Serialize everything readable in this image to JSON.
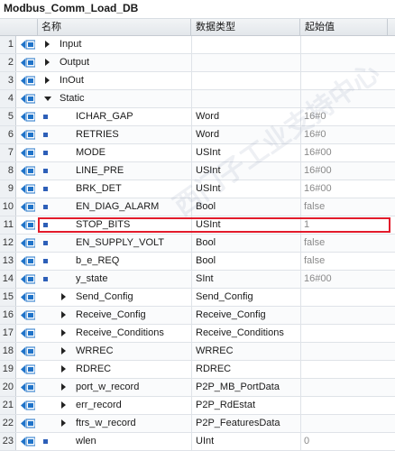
{
  "title": "Modbus_Comm_Load_DB",
  "columns": {
    "name": "名称",
    "data_type": "数据类型",
    "start_value": "起始值"
  },
  "colors": {
    "highlight": "#e21b2b",
    "bullet": "#2d5fb8",
    "io_icon": "#1f73c9"
  },
  "rows": [
    {
      "num": "1",
      "name": "Input",
      "type": "",
      "init": "",
      "arrow": "right",
      "level": 0
    },
    {
      "num": "2",
      "name": "Output",
      "type": "",
      "init": "",
      "arrow": "right",
      "level": 0
    },
    {
      "num": "3",
      "name": "InOut",
      "type": "",
      "init": "",
      "arrow": "right",
      "level": 0
    },
    {
      "num": "4",
      "name": "Static",
      "type": "",
      "init": "",
      "arrow": "down",
      "level": 0
    },
    {
      "num": "5",
      "name": "ICHAR_GAP",
      "type": "Word",
      "init": "16#0",
      "arrow": "",
      "level": 1
    },
    {
      "num": "6",
      "name": "RETRIES",
      "type": "Word",
      "init": "16#0",
      "arrow": "",
      "level": 1
    },
    {
      "num": "7",
      "name": "MODE",
      "type": "USInt",
      "init": "16#00",
      "arrow": "",
      "level": 1
    },
    {
      "num": "8",
      "name": "LINE_PRE",
      "type": "USInt",
      "init": "16#00",
      "arrow": "",
      "level": 1
    },
    {
      "num": "9",
      "name": "BRK_DET",
      "type": "USInt",
      "init": "16#00",
      "arrow": "",
      "level": 1
    },
    {
      "num": "10",
      "name": "EN_DIAG_ALARM",
      "type": "Bool",
      "init": "false",
      "arrow": "",
      "level": 1
    },
    {
      "num": "11",
      "name": "STOP_BITS",
      "type": "USInt",
      "init": "1",
      "arrow": "",
      "level": 1,
      "highlight": true
    },
    {
      "num": "12",
      "name": "EN_SUPPLY_VOLT",
      "type": "Bool",
      "init": "false",
      "arrow": "",
      "level": 1
    },
    {
      "num": "13",
      "name": "b_e_REQ",
      "type": "Bool",
      "init": "false",
      "arrow": "",
      "level": 1
    },
    {
      "num": "14",
      "name": "y_state",
      "type": "SInt",
      "init": "16#00",
      "arrow": "",
      "level": 1
    },
    {
      "num": "15",
      "name": "Send_Config",
      "type": "Send_Config",
      "init": "",
      "arrow": "right",
      "level": 1
    },
    {
      "num": "16",
      "name": "Receive_Config",
      "type": "Receive_Config",
      "init": "",
      "arrow": "right",
      "level": 1
    },
    {
      "num": "17",
      "name": "Receive_Conditions",
      "type": "Receive_Conditions",
      "init": "",
      "arrow": "right",
      "level": 1
    },
    {
      "num": "18",
      "name": "WRREC",
      "type": "WRREC",
      "init": "",
      "arrow": "right",
      "level": 1
    },
    {
      "num": "19",
      "name": "RDREC",
      "type": "RDREC",
      "init": "",
      "arrow": "right",
      "level": 1
    },
    {
      "num": "20",
      "name": "port_w_record",
      "type": "P2P_MB_PortData",
      "init": "",
      "arrow": "right",
      "level": 1
    },
    {
      "num": "21",
      "name": "err_record",
      "type": "P2P_RdEstat",
      "init": "",
      "arrow": "right",
      "level": 1
    },
    {
      "num": "22",
      "name": "ftrs_w_record",
      "type": "P2P_FeaturesData",
      "init": "",
      "arrow": "right",
      "level": 1
    },
    {
      "num": "23",
      "name": "wlen",
      "type": "UInt",
      "init": "0",
      "arrow": "",
      "level": 1
    }
  ]
}
